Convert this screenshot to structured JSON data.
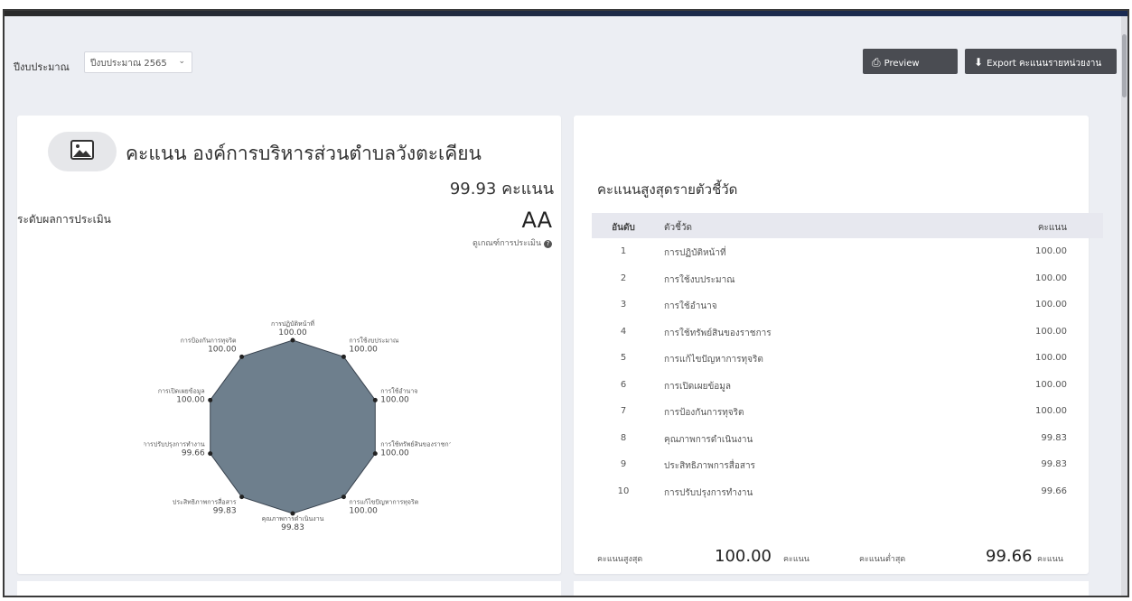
{
  "header": {
    "year_label": "ปีงบประมาณ",
    "year_selected": "ปีงบประมาณ 2565",
    "preview_label": "Preview",
    "export_label": "Export คะแนนรายหน่วยงาน"
  },
  "summary": {
    "title": "คะแนน องค์การบริหารส่วนตำบลวังตะเคียน",
    "score_text": "99.93 คะแนน",
    "level_label": "ระดับผลการประเมิน",
    "grade": "AA",
    "criteria_link": "ดูเกณฑ์การประเมิน"
  },
  "radar": {
    "labels": [
      "การปฏิบัติหน้าที่",
      "การใช้งบประมาณ",
      "การใช้อำนาจ",
      "การใช้ทรัพย์สินของราชการ",
      "การแก้ไขปัญหาการทุจริต",
      "คุณภาพการดำเนินงาน",
      "ประสิทธิภาพการสื่อสาร",
      "การปรับปรุงการทำงาน",
      "การเปิดเผยข้อมูล",
      "การป้องกันการทุจริต"
    ],
    "values": [
      "100.00",
      "100.00",
      "100.00",
      "100.00",
      "100.00",
      "99.83",
      "99.83",
      "99.66",
      "100.00",
      "100.00"
    ],
    "fill_color": "#6e7f8d"
  },
  "ranking": {
    "title": "คะแนนสูงสุดรายตัวชี้วัด",
    "columns": [
      "อันดับ",
      "ตัวชี้วัด",
      "คะแนน"
    ],
    "rows": [
      {
        "rank": "1",
        "name": "การปฏิบัติหน้าที่",
        "score": "100.00"
      },
      {
        "rank": "2",
        "name": "การใช้งบประมาณ",
        "score": "100.00"
      },
      {
        "rank": "3",
        "name": "การใช้อำนาจ",
        "score": "100.00"
      },
      {
        "rank": "4",
        "name": "การใช้ทรัพย์สินของราชการ",
        "score": "100.00"
      },
      {
        "rank": "5",
        "name": "การแก้ไขปัญหาการทุจริต",
        "score": "100.00"
      },
      {
        "rank": "6",
        "name": "การเปิดเผยข้อมูล",
        "score": "100.00"
      },
      {
        "rank": "7",
        "name": "การป้องกันการทุจริต",
        "score": "100.00"
      },
      {
        "rank": "8",
        "name": "คุณภาพการดำเนินงาน",
        "score": "99.83"
      },
      {
        "rank": "9",
        "name": "ประสิทธิภาพการสื่อสาร",
        "score": "99.83"
      },
      {
        "rank": "10",
        "name": "การปรับปรุงการทำงาน",
        "score": "99.66"
      }
    ],
    "max_label": "คะแนนสูงสุด",
    "max_value": "100.00",
    "min_label": "คะแนนต่ำสุด",
    "min_value": "99.66",
    "unit": "คะแนน"
  }
}
